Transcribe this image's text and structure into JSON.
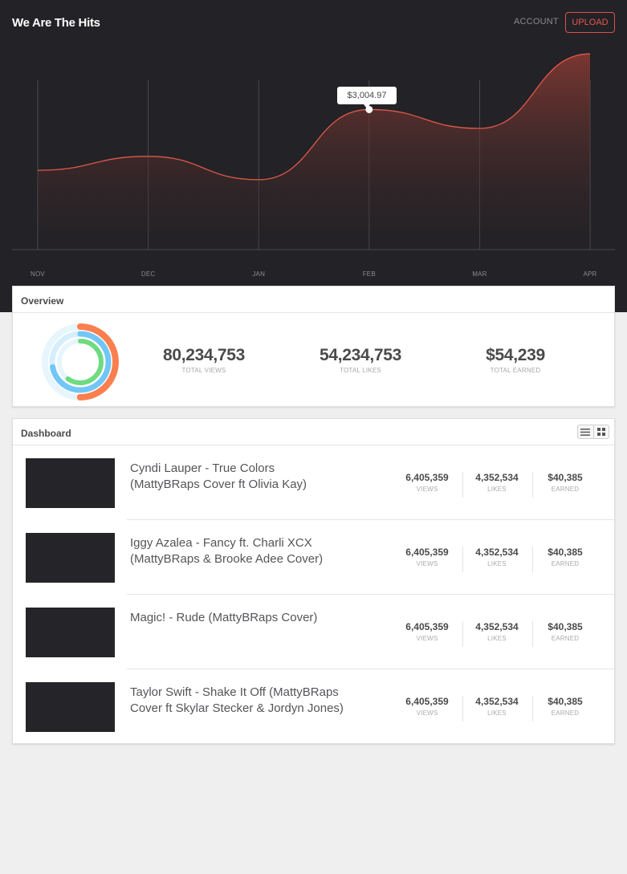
{
  "header": {
    "logo": "We Are The Hits",
    "account_label": "ACCOUNT",
    "upload_label": "UPLOAD"
  },
  "chart_data": {
    "type": "area",
    "categories": [
      "NOV",
      "DEC",
      "JAN",
      "FEB",
      "MAR",
      "APR"
    ],
    "values": [
      1700,
      2000,
      1500,
      3004.97,
      2600,
      4200
    ],
    "tooltip_label": "$3,004.97",
    "highlighted_category": "FEB",
    "line_color": "#e0584a"
  },
  "overview": {
    "title": "Overview",
    "stats": [
      {
        "value": "80,234,753",
        "label": "TOTAL VIEWS"
      },
      {
        "value": "54,234,753",
        "label": "TOTAL LIKES"
      },
      {
        "value": "$54,239",
        "label": "TOTAL EARNED"
      }
    ],
    "rings": [
      {
        "fraction": 0.5,
        "color": "#fb7f4e",
        "track": "#e7f5fd"
      },
      {
        "fraction": 0.72,
        "color": "#72c6f6",
        "track": "#d4eefc"
      },
      {
        "fraction": 0.6,
        "color": "#6fdb80",
        "track": "#e7f5fd"
      }
    ]
  },
  "dashboard": {
    "title": "Dashboard",
    "rows": [
      {
        "title": "Cyndi Lauper - True Colors (MattyBRaps Cover ft Olivia Kay)",
        "views": "6,405,359",
        "likes": "4,352,534",
        "earned": "$40,385"
      },
      {
        "title": "Iggy Azalea - Fancy ft. Charli XCX (MattyBRaps & Brooke Adee Cover)",
        "views": "6,405,359",
        "likes": "4,352,534",
        "earned": "$40,385"
      },
      {
        "title": "Magic! - Rude (MattyBRaps Cover)",
        "views": "6,405,359",
        "likes": "4,352,534",
        "earned": "$40,385"
      },
      {
        "title": "Taylor Swift - Shake It Off (MattyBRaps Cover ft Skylar Stecker & Jordyn Jones)",
        "views": "6,405,359",
        "likes": "4,352,534",
        "earned": "$40,385"
      }
    ],
    "labels": {
      "views": "VIEWS",
      "likes": "LIKES",
      "earned": "EARNED"
    }
  }
}
